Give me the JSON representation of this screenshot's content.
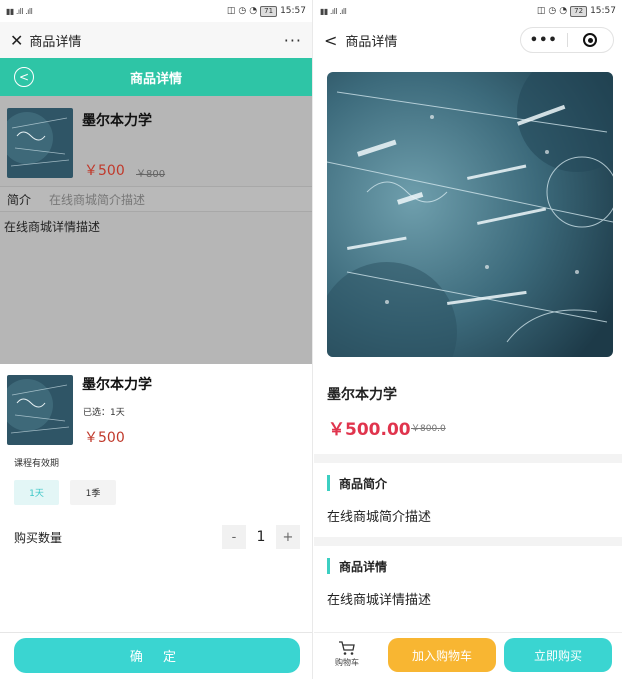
{
  "left_screen": {
    "status": {
      "time": "15:57",
      "battery": "71"
    },
    "nav": {
      "title": "商品详情"
    },
    "header": {
      "title": "商品详情"
    },
    "product": {
      "name": "墨尔本力学",
      "price": "￥500",
      "original_price": "￥800"
    },
    "intro": {
      "label": "简介",
      "text": "在线商城简介描述"
    },
    "detail_text": "在线商城详情描述",
    "sheet": {
      "name": "墨尔本力学",
      "selected": "已选：1天",
      "price": "￥500",
      "validity_label": "课程有效期",
      "options": [
        "1天",
        "1季"
      ],
      "quantity_label": "购买数量",
      "quantity": "1",
      "minus": "-",
      "plus": "+",
      "confirm_label": "确 定"
    }
  },
  "right_screen": {
    "status": {
      "time": "15:57",
      "battery": "72"
    },
    "nav": {
      "title": "商品详情"
    },
    "product": {
      "name": "墨尔本力学",
      "price": "￥500.00",
      "original_price": "￥800.0"
    },
    "intro_section": {
      "title": "商品简介",
      "text": "在线商城简介描述"
    },
    "detail_section": {
      "title": "商品详情",
      "text": "在线商城详情描述"
    },
    "bottom_bar": {
      "cart_label": "购物车",
      "add_to_cart": "加入购物车",
      "buy_now": "立即购买"
    }
  },
  "colors": {
    "header_teal": "#2ec5a6",
    "button_cyan": "#3ad5d1",
    "add_cart_orange": "#f8b632",
    "price_red": "#e0344d"
  },
  "icons": [
    "close-icon",
    "more-icon",
    "back-circle-icon",
    "back-icon",
    "capsule-more-icon",
    "capsule-target-icon",
    "cart-icon"
  ]
}
